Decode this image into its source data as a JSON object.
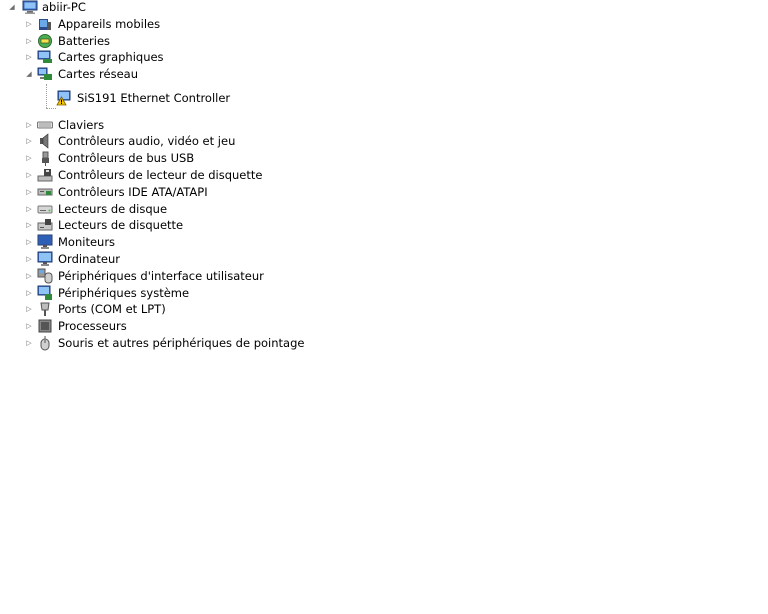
{
  "root": {
    "label": "abiir-PC",
    "icon": "computer-icon",
    "expanded": true
  },
  "categories": [
    {
      "label": "Appareils mobiles",
      "icon": "mobile-device-icon",
      "expanded": false
    },
    {
      "label": "Batteries",
      "icon": "battery-icon",
      "expanded": false
    },
    {
      "label": "Cartes graphiques",
      "icon": "display-adapter-icon",
      "expanded": false
    },
    {
      "label": "Cartes réseau",
      "icon": "network-adapter-icon",
      "expanded": true,
      "children": [
        {
          "label": "SiS191 Ethernet Controller",
          "icon": "network-warning-icon",
          "status": "warning"
        }
      ]
    },
    {
      "label": "Claviers",
      "icon": "keyboard-icon",
      "expanded": false
    },
    {
      "label": "Contrôleurs audio, vidéo et jeu",
      "icon": "speaker-icon",
      "expanded": false
    },
    {
      "label": "Contrôleurs de bus USB",
      "icon": "usb-icon",
      "expanded": false
    },
    {
      "label": "Contrôleurs de lecteur de disquette",
      "icon": "floppy-controller-icon",
      "expanded": false
    },
    {
      "label": "Contrôleurs IDE ATA/ATAPI",
      "icon": "ide-controller-icon",
      "expanded": false
    },
    {
      "label": "Lecteurs de disque",
      "icon": "disk-drive-icon",
      "expanded": false
    },
    {
      "label": "Lecteurs de disquette",
      "icon": "floppy-drive-icon",
      "expanded": false
    },
    {
      "label": "Moniteurs",
      "icon": "monitor-icon",
      "expanded": false
    },
    {
      "label": "Ordinateur",
      "icon": "computer-icon",
      "expanded": false
    },
    {
      "label": "Périphériques d'interface utilisateur",
      "icon": "hid-icon",
      "expanded": false
    },
    {
      "label": "Périphériques système",
      "icon": "system-device-icon",
      "expanded": false
    },
    {
      "label": "Ports (COM et LPT)",
      "icon": "port-icon",
      "expanded": false
    },
    {
      "label": "Processeurs",
      "icon": "processor-icon",
      "expanded": false
    },
    {
      "label": "Souris et autres périphériques de pointage",
      "icon": "mouse-icon",
      "expanded": false
    }
  ],
  "colors": {
    "expander": "#6e6e6e",
    "tree_lines": "#a0a0a0",
    "warning": "#f2c200"
  }
}
